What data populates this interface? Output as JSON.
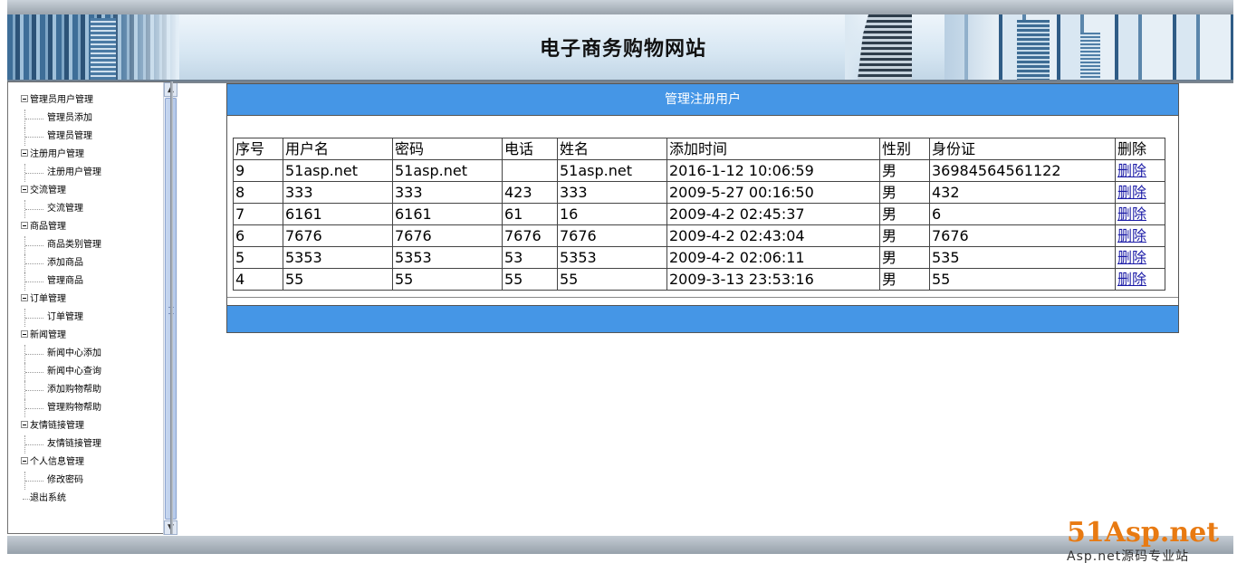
{
  "header": {
    "title": "电子商务购物网站"
  },
  "sidebar": {
    "groups": [
      {
        "label": "管理员用户管理",
        "items": [
          "管理员添加",
          "管理员管理"
        ]
      },
      {
        "label": "注册用户管理",
        "items": [
          "注册用户管理"
        ]
      },
      {
        "label": "交流管理",
        "items": [
          "交流管理"
        ]
      },
      {
        "label": "商品管理",
        "items": [
          "商品类别管理",
          "添加商品",
          "管理商品"
        ]
      },
      {
        "label": "订单管理",
        "items": [
          "订单管理"
        ]
      },
      {
        "label": "新闻管理",
        "items": [
          "新闻中心添加",
          "新闻中心查询",
          "添加购物帮助",
          "管理购物帮助"
        ]
      },
      {
        "label": "友情链接管理",
        "items": [
          "友情链接管理"
        ]
      },
      {
        "label": "个人信息管理",
        "items": [
          "修改密码"
        ]
      }
    ],
    "logout": "退出系统"
  },
  "panel": {
    "title": "管理注册用户",
    "columns": [
      "序号",
      "用户名",
      "密码",
      "电话",
      "姓名",
      "添加时间",
      "性别",
      "身份证",
      "删除"
    ],
    "rows": [
      [
        "9",
        "51asp.net",
        "51asp.net",
        "",
        "51asp.net",
        "2016-1-12 10:06:59",
        "男",
        "36984564561122",
        "删除"
      ],
      [
        "8",
        "333",
        "333",
        "423",
        "333",
        "2009-5-27 00:16:50",
        "男",
        "432",
        "删除"
      ],
      [
        "7",
        "6161",
        "6161",
        "61",
        "16",
        "2009-4-2 02:45:37",
        "男",
        "6",
        "删除"
      ],
      [
        "6",
        "7676",
        "7676",
        "7676",
        "7676",
        "2009-4-2 02:43:04",
        "男",
        "7676",
        "删除"
      ],
      [
        "5",
        "5353",
        "5353",
        "53",
        "5353",
        "2009-4-2 02:06:11",
        "男",
        "535",
        "删除"
      ],
      [
        "4",
        "55",
        "55",
        "55",
        "55",
        "2009-3-13 23:53:16",
        "男",
        "55",
        "删除"
      ]
    ]
  },
  "watermark": {
    "main": "51Asp.net",
    "sub": "Asp.net源码专业站"
  },
  "colors": {
    "panel_header": "#4596e6",
    "link": "#1a1aa6",
    "watermark": "#e87a12"
  }
}
